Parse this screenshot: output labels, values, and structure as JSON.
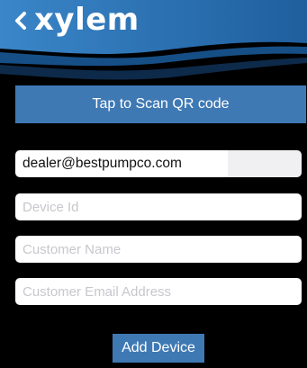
{
  "header": {
    "logo_text": "xylem",
    "back_icon": "chevron-left-icon"
  },
  "scan": {
    "label": "Tap to Scan QR code"
  },
  "form": {
    "email_value": "dealer@bestpumpco.com",
    "device_id_placeholder": "Device Id",
    "customer_name_placeholder": "Customer Name",
    "customer_email_placeholder": "Customer Email Address"
  },
  "actions": {
    "add_device_label": "Add Device"
  },
  "colors": {
    "brand_blue": "#3f79b4",
    "header_blue": "#2f73b8",
    "background": "#000000"
  }
}
